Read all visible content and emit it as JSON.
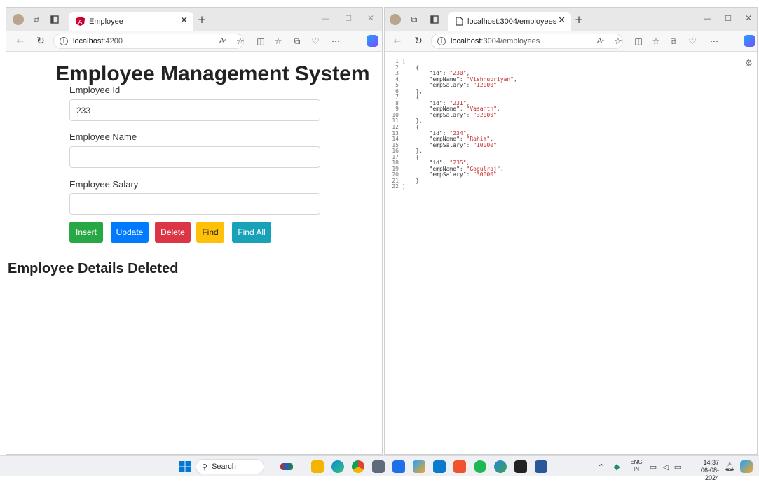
{
  "left_window": {
    "tab_title": "Employee",
    "url_host": "localhost",
    "url_path": ":4200",
    "page": {
      "heading": "Employee Management System",
      "fields": [
        {
          "label": "Employee Id",
          "value": "233"
        },
        {
          "label": "Employee Name",
          "value": ""
        },
        {
          "label": "Employee Salary",
          "value": ""
        }
      ],
      "buttons": [
        {
          "label": "Insert",
          "color": "#28a745"
        },
        {
          "label": "Update",
          "color": "#007bff"
        },
        {
          "label": "Delete",
          "color": "#dc3545"
        },
        {
          "label": "Find",
          "color": "#ffc107"
        },
        {
          "label": "Find All",
          "color": "#17a2b8"
        }
      ],
      "status_message": "Employee Details Deleted"
    }
  },
  "right_window": {
    "tab_title": "localhost:3004/employees",
    "url_host": "localhost",
    "url_path": ":3004/employees",
    "json_lines": [
      "[",
      "    {",
      "        \"id\": \"230\",",
      "        \"empName\": \"Vishnupriyan\",",
      "        \"empSalary\": \"12000\"",
      "    },",
      "    {",
      "        \"id\": \"231\",",
      "        \"empName\": \"Vasanth\",",
      "        \"empSalary\": \"32000\"",
      "    },",
      "    {",
      "        \"id\": \"234\",",
      "        \"empName\": \"Rahim\",",
      "        \"empSalary\": \"10000\"",
      "    },",
      "    {",
      "        \"id\": \"235\",",
      "        \"empName\": \"Gogulraj\",",
      "        \"empSalary\": \"30000\"",
      "    }",
      "]"
    ]
  },
  "toolbar_icons": [
    "back-icon",
    "refresh-icon",
    "info-icon",
    "read-aloud-icon",
    "favorite-star-icon",
    "split-screen-icon",
    "favorites-icon",
    "collections-icon",
    "extensions-icon",
    "more-icon",
    "copilot-icon"
  ],
  "taskbar": {
    "search_label": "Search",
    "lang_top": "ENG",
    "lang_bottom": "IN",
    "time": "14:37",
    "date": "06-08-2024",
    "icons": [
      "start-icon",
      "search-icon",
      "widgets-icon",
      "file-explorer-icon",
      "edge-icon",
      "chrome-icon",
      "camera-icon",
      "store-icon",
      "copilot-icon",
      "vscode-icon",
      "brave-icon",
      "spotify-icon",
      "edge-beta-icon",
      "terminal-icon",
      "word-icon"
    ]
  },
  "colors": {
    "accent": "#0078d4",
    "json_string": "#c62828",
    "titlebar": "#e8e8e8"
  }
}
